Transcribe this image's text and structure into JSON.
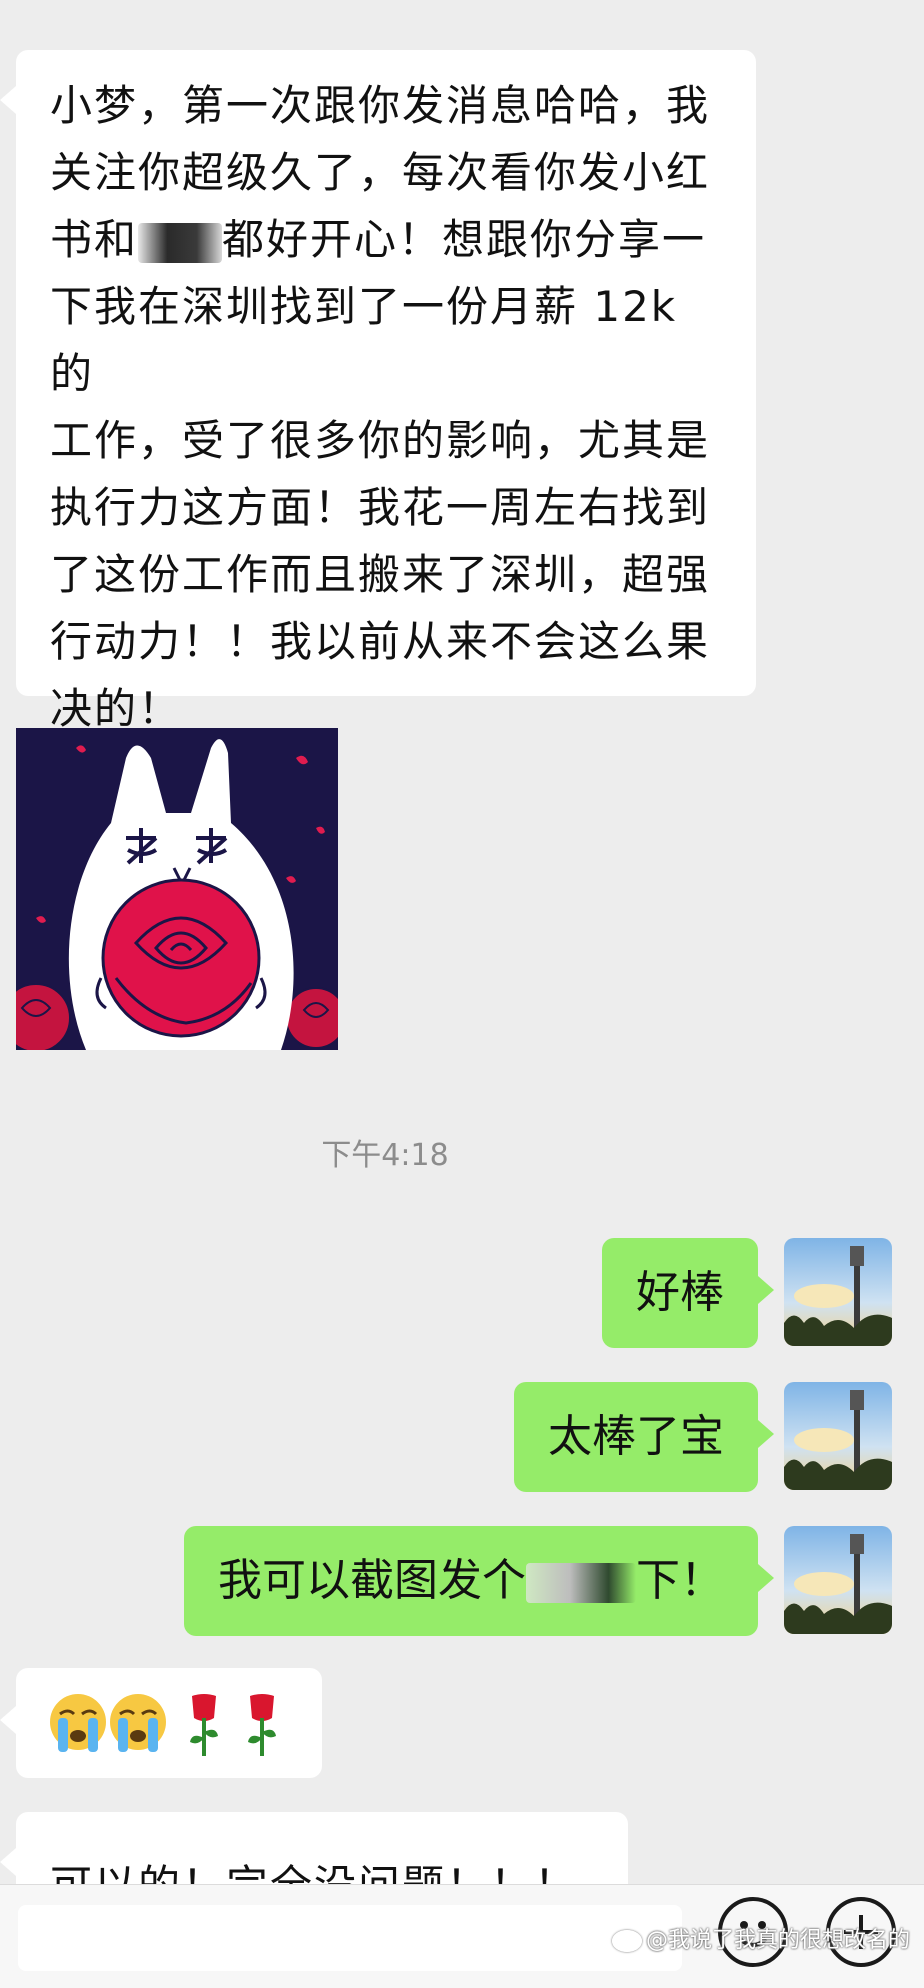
{
  "chat": {
    "incoming_long_message": {
      "lines": [
        "小梦，第一次跟你发消息哈哈，我",
        "关注你超级久了，每次看你发小红",
        "书和",
        "都好开心！想跟你分享一",
        "下我在深圳找到了一份月薪 12k 的",
        "工作，受了很多你的影响，尤其是",
        "执行力这方面！我花一周左右找到",
        "了这份工作而且搬来了深圳，超强",
        "行动力！！我以前从来不会这么果",
        "决的！"
      ]
    },
    "timestamp": "下午4:18",
    "outgoing": [
      {
        "text": "好棒"
      },
      {
        "text": "太棒了宝"
      },
      {
        "text_before": "我可以截图发个",
        "text_after": "下！"
      }
    ],
    "incoming_emoji_message": {
      "emojis": [
        "😭",
        "😭",
        "🌹",
        "🌹"
      ]
    },
    "incoming_last_message": "可以的！完全没问题！！！"
  },
  "colors": {
    "background": "#ededed",
    "incoming_bubble": "#ffffff",
    "outgoing_bubble": "#95ec69",
    "timestamp_text": "#8c8c8c"
  },
  "input_bar": {
    "icons": [
      "emoji-icon",
      "plus-icon"
    ]
  },
  "watermark": {
    "text": "@我说了我真的很想改名的"
  }
}
